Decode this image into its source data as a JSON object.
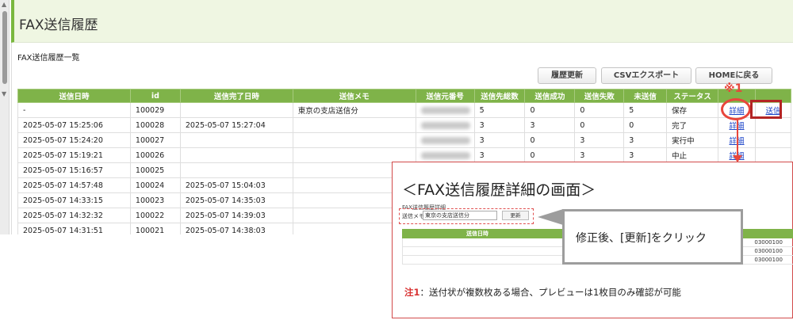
{
  "header": {
    "title": "FAX送信履歴"
  },
  "section_title": "FAX送信履歴一覧",
  "toolbar": {
    "refresh_label": "履歴更新",
    "csv_label": "CSVエクスポート",
    "home_label": "HOMEに戻る"
  },
  "columns": [
    "送信日時",
    "id",
    "送信完了日時",
    "送信メモ",
    "送信元番号",
    "送信先総数",
    "送信成功",
    "送信失敗",
    "未送信",
    "ステータス"
  ],
  "rows": [
    {
      "sent_at": "-",
      "id": "100029",
      "completed_at": "",
      "memo": "東京の支店送信分",
      "dest_total": "5",
      "success": "0",
      "failed": "0",
      "unsent": "5",
      "status": "保存",
      "detail": "詳細",
      "send": "送信"
    },
    {
      "sent_at": "2025-05-07 15:25:06",
      "id": "100028",
      "completed_at": "2025-05-07 15:27:04",
      "memo": "",
      "dest_total": "3",
      "success": "3",
      "failed": "0",
      "unsent": "0",
      "status": "完了",
      "detail": "詳細"
    },
    {
      "sent_at": "2025-05-07 15:24:20",
      "id": "100027",
      "completed_at": "",
      "memo": "",
      "dest_total": "3",
      "success": "0",
      "failed": "3",
      "unsent": "3",
      "status": "実行中",
      "detail": "詳細"
    },
    {
      "sent_at": "2025-05-07 15:19:21",
      "id": "100026",
      "completed_at": "",
      "memo": "",
      "dest_total": "3",
      "success": "0",
      "failed": "3",
      "unsent": "3",
      "status": "中止",
      "detail": "詳細"
    },
    {
      "sent_at": "2025-05-07 15:16:57",
      "id": "100025",
      "completed_at": "",
      "memo": "",
      "dest_total": "",
      "success": "",
      "failed": "",
      "unsent": "",
      "status": "",
      "detail": ""
    },
    {
      "sent_at": "2025-05-07 14:57:48",
      "id": "100024",
      "completed_at": "2025-05-07 15:04:03",
      "memo": "",
      "dest_total": "",
      "success": "",
      "failed": "",
      "unsent": "",
      "status": "",
      "detail": ""
    },
    {
      "sent_at": "2025-05-07 14:33:15",
      "id": "100023",
      "completed_at": "2025-05-07 14:35:03",
      "memo": "",
      "dest_total": "",
      "success": "",
      "failed": "",
      "unsent": "",
      "status": "",
      "detail": ""
    },
    {
      "sent_at": "2025-05-07 14:32:32",
      "id": "100022",
      "completed_at": "2025-05-07 14:39:03",
      "memo": "",
      "dest_total": "",
      "success": "",
      "failed": "",
      "unsent": "",
      "status": "",
      "detail": ""
    },
    {
      "sent_at": "2025-05-07 14:31:51",
      "id": "100021",
      "completed_at": "2025-05-07 14:38:03",
      "memo": "",
      "dest_total": "",
      "success": "",
      "failed": "",
      "unsent": "",
      "status": "",
      "detail": ""
    }
  ],
  "annotation": {
    "mark": "※1",
    "accent_color": "#e8463c"
  },
  "detail_panel": {
    "title": "＜FAX送信履歴詳細の画面＞",
    "subtitle": "FAX送信履歴詳細",
    "memo_label": "送信メモ",
    "memo_value": "東京の支店送信分",
    "update_label": "更新",
    "table_header": "送信日時",
    "partial_numbers": [
      "03000100",
      "03000100",
      "03000100"
    ]
  },
  "callout": {
    "text": "修正後、[更新]をクリック"
  },
  "note": {
    "label": "注1",
    "text": "：送付状が複数枚ある場合、プレビューは1枚目のみ確認が可能"
  }
}
